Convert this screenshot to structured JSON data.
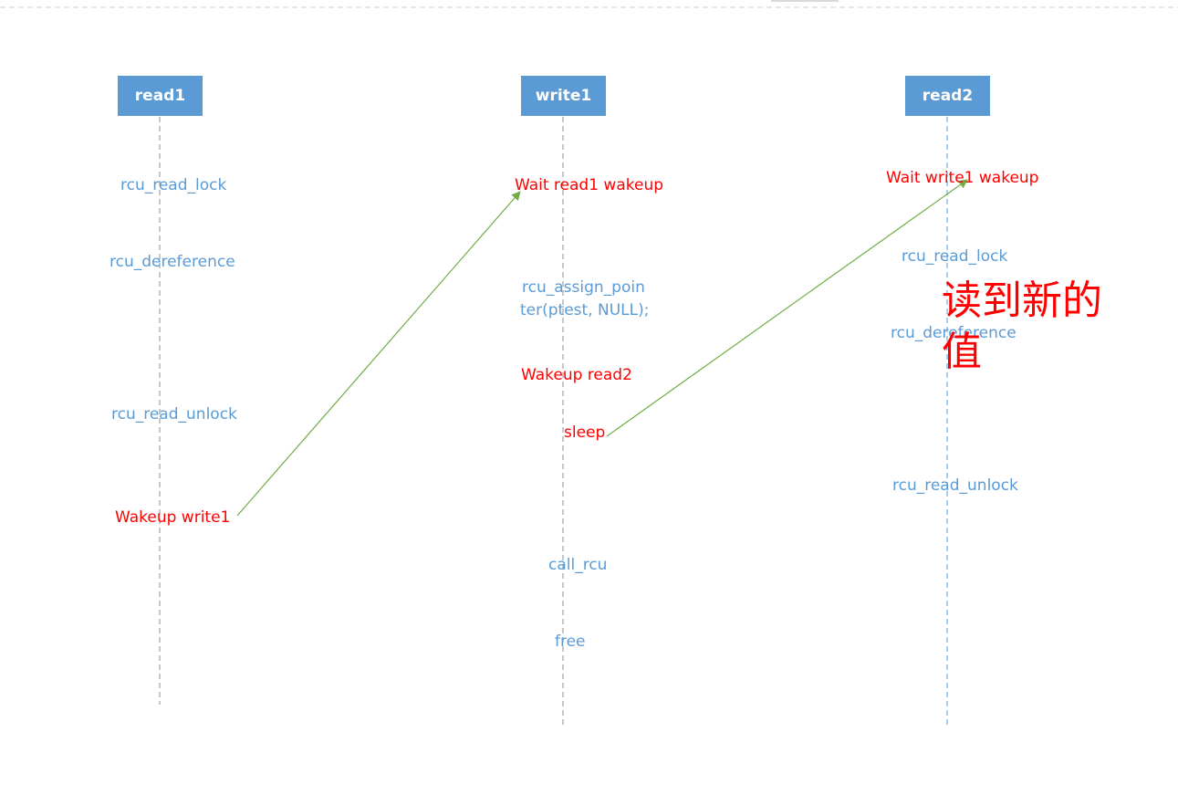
{
  "colors": {
    "box": "#5b9bd5",
    "note": "#ff0000",
    "step": "#5b9bd5",
    "arrow": "#70ad47",
    "lifeline": "#8f8f8f"
  },
  "actors": {
    "read1": "read1",
    "write1": "write1",
    "read2": "read2"
  },
  "read1": {
    "s1": "rcu_read_lock",
    "s2": "rcu_dereference",
    "s3": "rcu_read_unlock",
    "s4": "Wakeup write1"
  },
  "write1": {
    "s1": "Wait read1 wakeup",
    "s2a": "rcu_assign_poin",
    "s2b": "ter(ptest, NULL);",
    "s3": "Wakeup read2",
    "s4": "sleep",
    "s5": "call_rcu",
    "s6": "free"
  },
  "read2": {
    "s1": "Wait write1 wakeup",
    "s2": "rcu_read_lock",
    "s3": "rcu_dereference",
    "s4": "rcu_read_unlock",
    "note": "读到新的值"
  }
}
